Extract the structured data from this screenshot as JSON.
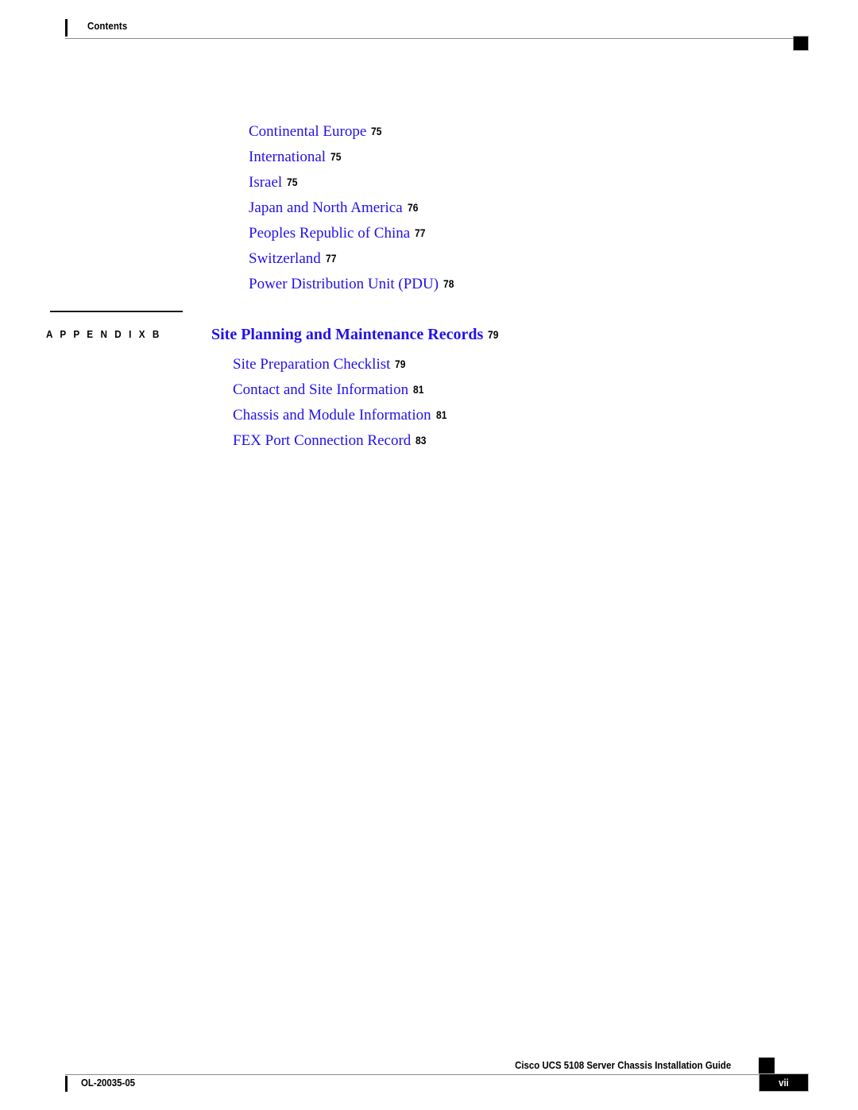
{
  "header": {
    "title": "Contents",
    "marker_icon": "black-square-marker"
  },
  "colors": {
    "link_blue": "#2211e8",
    "text_black": "#000000",
    "rule_gray": "#8a8a8a"
  },
  "toc": {
    "front_entries": [
      {
        "title": "Continental Europe",
        "page": "75"
      },
      {
        "title": "International",
        "page": "75"
      },
      {
        "title": "Israel",
        "page": "75"
      },
      {
        "title": "Japan and North America",
        "page": "76"
      },
      {
        "title": "Peoples Republic of China",
        "page": "77"
      },
      {
        "title": "Switzerland",
        "page": "77"
      },
      {
        "title": "Power Distribution Unit (PDU)",
        "page": "78"
      }
    ],
    "appendix": {
      "label": "A P P E N D I X   B",
      "heading": {
        "title": "Site Planning and Maintenance Records",
        "page": "79"
      },
      "entries": [
        {
          "title": "Site Preparation Checklist",
          "page": "79"
        },
        {
          "title": "Contact and Site Information",
          "page": "81"
        },
        {
          "title": "Chassis and Module Information",
          "page": "81"
        },
        {
          "title": "FEX Port Connection Record",
          "page": "83"
        }
      ]
    }
  },
  "footer": {
    "guide_title": "Cisco UCS 5108 Server Chassis Installation Guide",
    "doc_id": "OL-20035-05",
    "page_number": "vii",
    "marker_icon": "black-square-marker"
  }
}
